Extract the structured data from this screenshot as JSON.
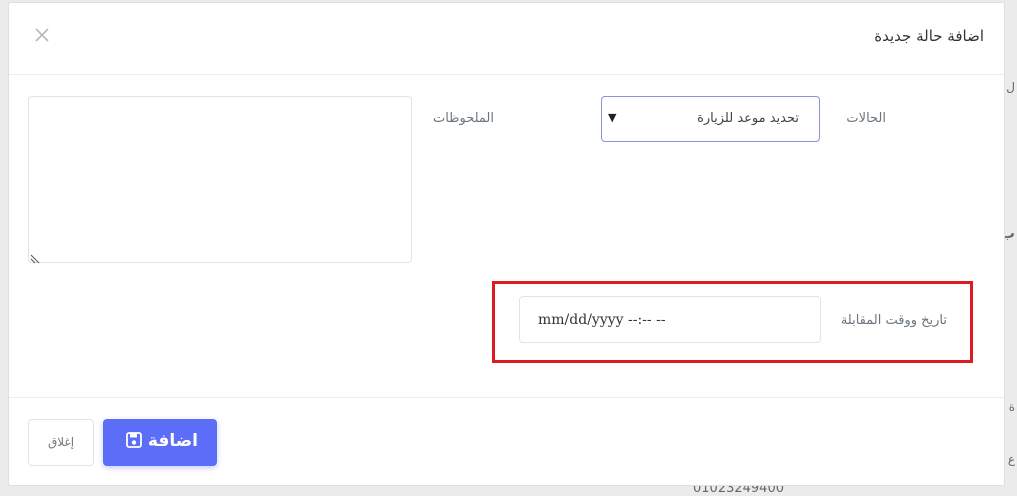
{
  "background": {
    "fragments": [
      "ل",
      "ب",
      "ة",
      "ع",
      "01023249400"
    ]
  },
  "modal": {
    "title": "اضافة حالة جديدة",
    "close_icon": "close-icon"
  },
  "form": {
    "status_label": "الحالات",
    "status_selected": "تحديد موعد للزيارة",
    "status_arrow": "▼",
    "notes_label": "الملحوظات",
    "notes_value": "",
    "datetime_label": "تاريخ ووقت المقابلة",
    "datetime_value": "mm/dd/yyyy --:-- --"
  },
  "footer": {
    "close_label": "إغلاق",
    "add_label": "اضافة",
    "add_icon": "save-icon"
  },
  "colors": {
    "primary": "#5c6ef8",
    "highlight": "#e01a22",
    "select_border": "#8a94d8"
  }
}
